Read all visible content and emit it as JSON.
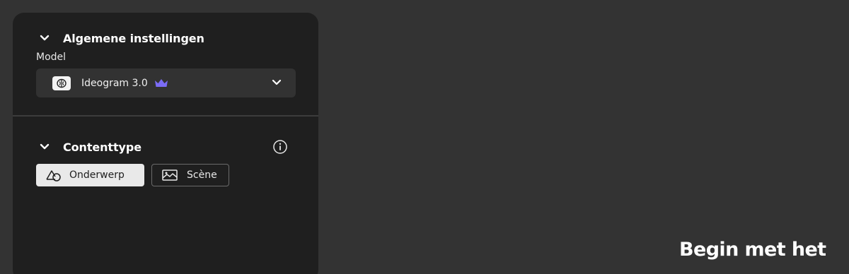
{
  "general_section": {
    "title": "Algemene instellingen",
    "model_label": "Model",
    "model_value": "Ideogram 3.0",
    "model_badge_icon": "crown-icon",
    "crown_color": "#7b6cf6"
  },
  "content_section": {
    "title": "Contenttype",
    "info_icon": "info-icon",
    "options": [
      {
        "label": "Onderwerp",
        "icon": "subject-shapes-icon",
        "selected": true
      },
      {
        "label": "Scène",
        "icon": "scene-landscape-icon",
        "selected": false
      }
    ]
  },
  "hero": {
    "text": "Begin met het"
  },
  "colors": {
    "background": "#333333",
    "panel": "#1f1f1f",
    "selected_button": "#e9e9e9"
  }
}
